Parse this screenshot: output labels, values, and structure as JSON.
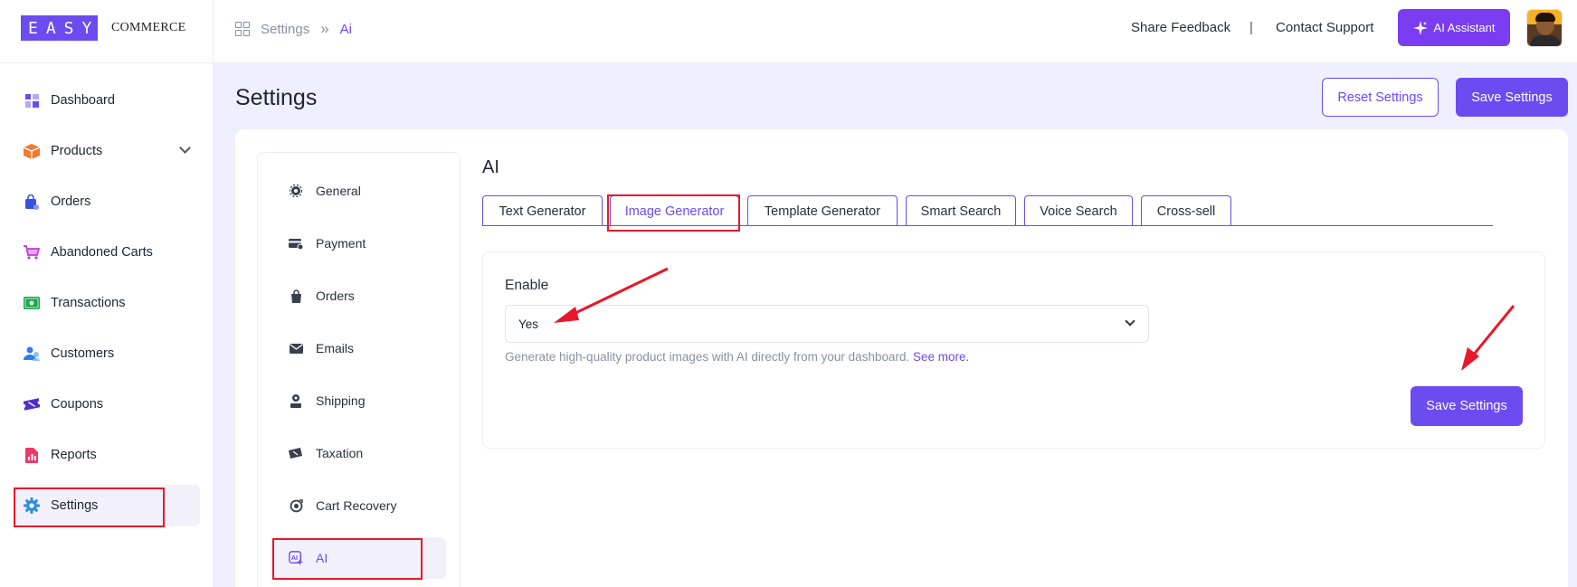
{
  "brand": {
    "logo_box": "EASY",
    "logo_text": "COMMERCE"
  },
  "breadcrumb": {
    "root": "Settings",
    "separator": "»",
    "current": "Ai"
  },
  "header": {
    "share_feedback": "Share Feedback",
    "divider": "|",
    "contact_support": "Contact Support",
    "ai_assistant": "AI Assistant"
  },
  "sidebar": {
    "items": [
      {
        "label": "Dashboard",
        "icon": "dashboard-icon"
      },
      {
        "label": "Products",
        "icon": "box-icon"
      },
      {
        "label": "Orders",
        "icon": "shopping-bag-icon"
      },
      {
        "label": "Abandoned Carts",
        "icon": "cart-icon"
      },
      {
        "label": "Transactions",
        "icon": "banknote-icon"
      },
      {
        "label": "Customers",
        "icon": "users-icon"
      },
      {
        "label": "Coupons",
        "icon": "ticket-icon"
      },
      {
        "label": "Reports",
        "icon": "report-icon"
      },
      {
        "label": "Settings",
        "icon": "gear-icon"
      }
    ],
    "active": "Settings"
  },
  "page": {
    "title": "Settings",
    "reset_button": "Reset Settings",
    "save_button": "Save Settings"
  },
  "settings_nav": {
    "items": [
      {
        "label": "General",
        "icon": "gear-icon"
      },
      {
        "label": "Payment",
        "icon": "card-icon"
      },
      {
        "label": "Orders",
        "icon": "bag-icon"
      },
      {
        "label": "Emails",
        "icon": "mail-icon"
      },
      {
        "label": "Shipping",
        "icon": "shipping-icon"
      },
      {
        "label": "Taxation",
        "icon": "tax-icon"
      },
      {
        "label": "Cart Recovery",
        "icon": "recovery-icon"
      },
      {
        "label": "AI",
        "icon": "ai-icon"
      }
    ],
    "active": "AI"
  },
  "ai_section": {
    "title": "AI",
    "tabs": [
      "Text Generator",
      "Image Generator",
      "Template Generator",
      "Smart Search",
      "Voice Search",
      "Cross-sell"
    ],
    "active_tab": "Image Generator",
    "enable_label": "Enable",
    "enable_value": "Yes",
    "help_text": "Generate high-quality product images with AI directly from your dashboard.",
    "help_link": "See more.",
    "save_button": "Save Settings"
  },
  "colors": {
    "accent": "#6c4bf0",
    "ai_button": "#7a3cf0",
    "highlight": "#e8182a",
    "main_bg": "#efefff"
  }
}
